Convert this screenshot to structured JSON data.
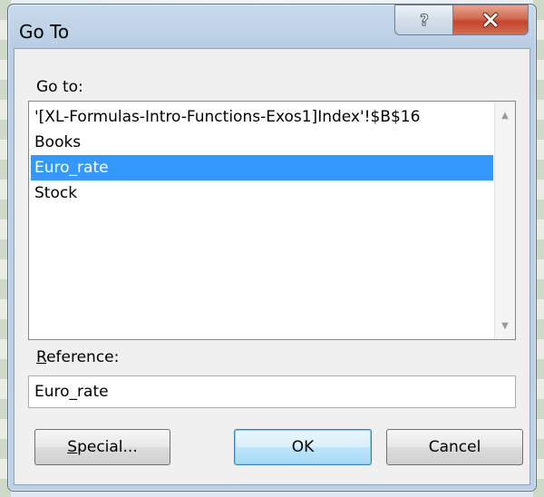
{
  "window": {
    "title": "Go To"
  },
  "caption": {
    "help_icon": "help-icon",
    "close_icon": "close-icon"
  },
  "goto": {
    "label": "Go to:",
    "items": [
      {
        "label": "'[XL-Formulas-Intro-Functions-Exos1]Index'!$B$16",
        "selected": false
      },
      {
        "label": "Books",
        "selected": false
      },
      {
        "label": "Euro_rate",
        "selected": true
      },
      {
        "label": "Stock",
        "selected": false
      }
    ]
  },
  "reference": {
    "label_accel": "R",
    "label_rest": "eference:",
    "value": "Euro_rate"
  },
  "buttons": {
    "special_accel": "S",
    "special_rest": "pecial...",
    "ok": "OK",
    "cancel": "Cancel"
  },
  "colors": {
    "selection": "#3399ff",
    "close_button": "#c4452a",
    "dialog_face": "#f0f0f0"
  }
}
